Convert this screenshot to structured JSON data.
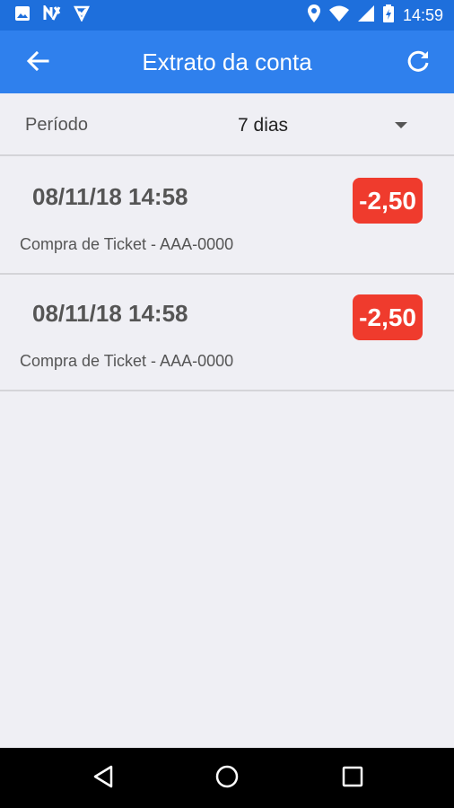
{
  "status_bar": {
    "time": "14:59",
    "left_icons": [
      "gallery-icon",
      "n-app-icon",
      "app-icon"
    ],
    "right_icons": [
      "location-icon",
      "wifi-icon",
      "signal-icon",
      "battery-charging-icon"
    ]
  },
  "app_bar": {
    "title": "Extrato da conta",
    "back_icon": "arrow-left-icon",
    "refresh_icon": "refresh-icon"
  },
  "filter": {
    "label": "Período",
    "value": "7 dias"
  },
  "transactions": [
    {
      "datetime": "08/11/18 14:58",
      "description": "Compra de Ticket - AAA-0000",
      "amount": "-2,50"
    },
    {
      "datetime": "08/11/18 14:58",
      "description": "Compra de Ticket - AAA-0000",
      "amount": "-2,50"
    }
  ],
  "nav_bar": {
    "icons": [
      "back-triangle-icon",
      "home-circle-icon",
      "recents-square-icon"
    ]
  },
  "colors": {
    "status_bar": "#1e6fdc",
    "app_bar": "#2f80ed",
    "background": "#efeff4",
    "amount_badge": "#ef3b2d"
  }
}
